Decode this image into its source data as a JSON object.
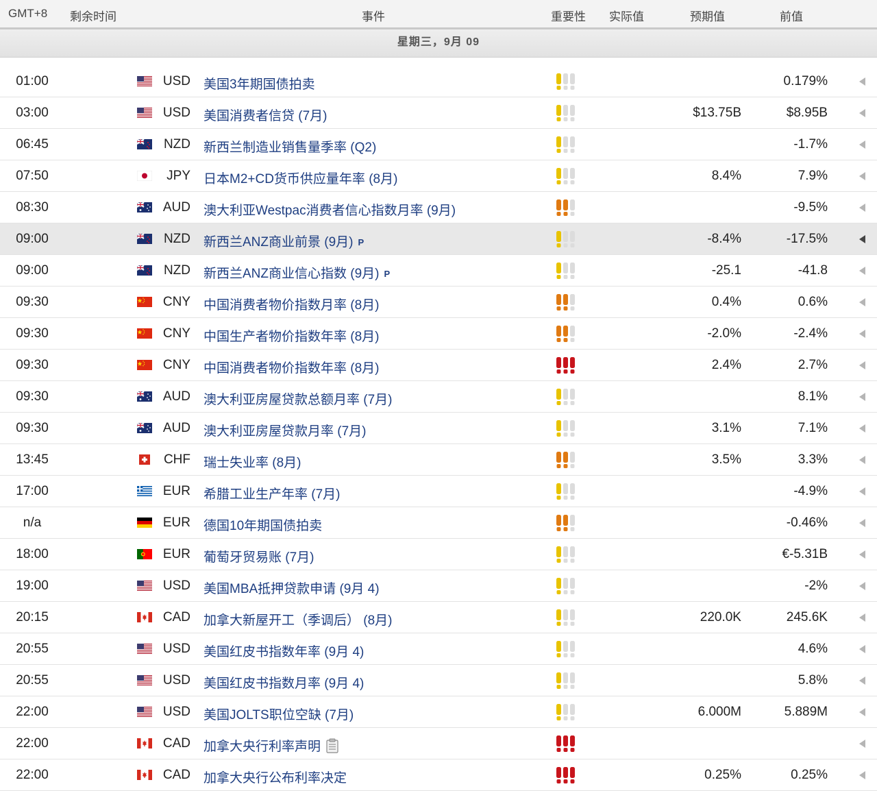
{
  "header": {
    "timezone": "GMT+8",
    "remaining": "剩余时间",
    "event": "事件",
    "importance": "重要性",
    "actual": "实际值",
    "forecast": "预期值",
    "previous": "前值"
  },
  "date_label": "星期三，9月 09",
  "colors": {
    "importance_red": "#c8151c",
    "importance_orange": "#e07a12",
    "importance_yellow": "#e8c300",
    "importance_empty": "#dcdcdc",
    "event_link": "#1f3f82"
  },
  "events": [
    {
      "time": "01:00",
      "flag": "us",
      "currency": "USD",
      "event": "美国3年期国债拍卖",
      "importance": 1,
      "actual": "",
      "forecast": "",
      "previous": "0.179%"
    },
    {
      "time": "03:00",
      "flag": "us",
      "currency": "USD",
      "event": "美国消费者信贷 (7月)",
      "importance": 1,
      "actual": "",
      "forecast": "$13.75B",
      "previous": "$8.95B"
    },
    {
      "time": "06:45",
      "flag": "nz",
      "currency": "NZD",
      "event": "新西兰制造业销售量季率 (Q2)",
      "importance": 1,
      "actual": "",
      "forecast": "",
      "previous": "-1.7%"
    },
    {
      "time": "07:50",
      "flag": "jp",
      "currency": "JPY",
      "event": "日本M2+CD货币供应量年率 (8月)",
      "importance": 1,
      "actual": "",
      "forecast": "8.4%",
      "previous": "7.9%"
    },
    {
      "time": "08:30",
      "flag": "au",
      "currency": "AUD",
      "event": "澳大利亚Westpac消费者信心指数月率 (9月)",
      "importance": 2,
      "actual": "",
      "forecast": "",
      "previous": "-9.5%"
    },
    {
      "time": "09:00",
      "flag": "nz",
      "currency": "NZD",
      "event": "新西兰ANZ商业前景 (9月)",
      "preliminary": "P",
      "importance": 1,
      "actual": "",
      "forecast": "-8.4%",
      "previous": "-17.5%",
      "selected": true
    },
    {
      "time": "09:00",
      "flag": "nz",
      "currency": "NZD",
      "event": "新西兰ANZ商业信心指数 (9月)",
      "preliminary": "P",
      "importance": 1,
      "actual": "",
      "forecast": "-25.1",
      "previous": "-41.8"
    },
    {
      "time": "09:30",
      "flag": "cn",
      "currency": "CNY",
      "event": "中国消费者物价指数月率 (8月)",
      "importance": 2,
      "actual": "",
      "forecast": "0.4%",
      "previous": "0.6%"
    },
    {
      "time": "09:30",
      "flag": "cn",
      "currency": "CNY",
      "event": "中国生产者物价指数年率 (8月)",
      "importance": 2,
      "actual": "",
      "forecast": "-2.0%",
      "previous": "-2.4%"
    },
    {
      "time": "09:30",
      "flag": "cn",
      "currency": "CNY",
      "event": "中国消费者物价指数年率 (8月)",
      "importance": 3,
      "actual": "",
      "forecast": "2.4%",
      "previous": "2.7%"
    },
    {
      "time": "09:30",
      "flag": "au",
      "currency": "AUD",
      "event": "澳大利亚房屋贷款总额月率 (7月)",
      "importance": 1,
      "actual": "",
      "forecast": "",
      "previous": "8.1%"
    },
    {
      "time": "09:30",
      "flag": "au",
      "currency": "AUD",
      "event": "澳大利亚房屋贷款月率 (7月)",
      "importance": 1,
      "actual": "",
      "forecast": "3.1%",
      "previous": "7.1%"
    },
    {
      "time": "13:45",
      "flag": "ch",
      "currency": "CHF",
      "event": "瑞士失业率 (8月)",
      "importance": 2,
      "actual": "",
      "forecast": "3.5%",
      "previous": "3.3%"
    },
    {
      "time": "17:00",
      "flag": "gr",
      "currency": "EUR",
      "event": "希腊工业生产年率 (7月)",
      "importance": 1,
      "actual": "",
      "forecast": "",
      "previous": "-4.9%"
    },
    {
      "time": "n/a",
      "flag": "de",
      "currency": "EUR",
      "event": "德国10年期国债拍卖",
      "importance": 2,
      "actual": "",
      "forecast": "",
      "previous": "-0.46%"
    },
    {
      "time": "18:00",
      "flag": "pt",
      "currency": "EUR",
      "event": "葡萄牙贸易账 (7月)",
      "importance": 1,
      "actual": "",
      "forecast": "",
      "previous": "€-5.31B"
    },
    {
      "time": "19:00",
      "flag": "us",
      "currency": "USD",
      "event": "美国MBA抵押贷款申请 (9月 4)",
      "importance": 1,
      "actual": "",
      "forecast": "",
      "previous": "-2%"
    },
    {
      "time": "20:15",
      "flag": "ca",
      "currency": "CAD",
      "event": "加拿大新屋开工（季调后） (8月)",
      "importance": 1,
      "actual": "",
      "forecast": "220.0K",
      "previous": "245.6K"
    },
    {
      "time": "20:55",
      "flag": "us",
      "currency": "USD",
      "event": "美国红皮书指数年率 (9月 4)",
      "importance": 1,
      "actual": "",
      "forecast": "",
      "previous": "4.6%"
    },
    {
      "time": "20:55",
      "flag": "us",
      "currency": "USD",
      "event": "美国红皮书指数月率 (9月 4)",
      "importance": 1,
      "actual": "",
      "forecast": "",
      "previous": "5.8%"
    },
    {
      "time": "22:00",
      "flag": "us",
      "currency": "USD",
      "event": "美国JOLTS职位空缺 (7月)",
      "importance": 1,
      "actual": "",
      "forecast": "6.000M",
      "previous": "5.889M"
    },
    {
      "time": "22:00",
      "flag": "ca",
      "currency": "CAD",
      "event": "加拿大央行利率声明",
      "has_document": true,
      "importance": 3,
      "actual": "",
      "forecast": "",
      "previous": ""
    },
    {
      "time": "22:00",
      "flag": "ca",
      "currency": "CAD",
      "event": "加拿大央行公布利率决定",
      "importance": 3,
      "actual": "",
      "forecast": "0.25%",
      "previous": "0.25%"
    }
  ]
}
